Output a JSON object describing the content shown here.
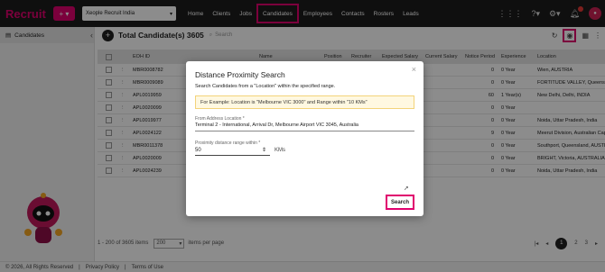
{
  "topbar": {
    "logo": "Recruit",
    "plus": "+ ▾",
    "org_select": "Xeople Recruit India",
    "nav": [
      "Home",
      "Clients",
      "Jobs",
      "Candidates",
      "Employees",
      "Contacts",
      "Rosters",
      "Leads"
    ],
    "active_nav": "Candidates",
    "accent": "#e0006e"
  },
  "sidebar": {
    "items": [
      {
        "label": "Candidates",
        "icon": "contacts-icon"
      }
    ]
  },
  "main": {
    "title": "Total Candidate(s) 3605",
    "search_placeholder": "Search"
  },
  "table": {
    "columns": [
      "",
      "",
      "EOH ID",
      "Name",
      "Position",
      "Recruiter",
      "Expected Salary",
      "Current Salary",
      "Notice Period",
      "Experience",
      "Location"
    ],
    "rows": [
      {
        "id": "MBR0008782",
        "notice": "0",
        "exp": "0 Year",
        "loc": "Wien, AUSTRIA"
      },
      {
        "id": "MBR0009089",
        "notice": "0",
        "exp": "0 Year",
        "loc": "FORTITUDE VALLEY, Queensland"
      },
      {
        "id": "APL0019959",
        "notice": "60",
        "exp": "1 Year(s)",
        "loc": "New Delhi, Delhi, INDIA"
      },
      {
        "id": "APL0020099",
        "notice": "0",
        "exp": "0 Year",
        "loc": ""
      },
      {
        "id": "APL0019977",
        "notice": "0",
        "exp": "0 Year",
        "loc": "Noida, Uttar Pradesh, India"
      },
      {
        "id": "APL0024122",
        "notice": "9",
        "exp": "0 Year",
        "loc": "Meerut Division, Australian Capit"
      },
      {
        "id": "MBR0011378",
        "notice": "0",
        "exp": "0 Year",
        "loc": "Southport, Queensland, AUSTRAL"
      },
      {
        "id": "APL0020009",
        "notice": "0",
        "exp": "0 Year",
        "loc": "BRIGHT, Victoria, AUSTRALIA"
      },
      {
        "id": "APL0024239",
        "notice": "0",
        "exp": "0 Year",
        "loc": "Noida, Uttar Pradesh, India"
      }
    ]
  },
  "pager": {
    "range": "1 - 200 of 3605 items",
    "per_page_value": "200",
    "per_page_label": "items per page",
    "pages": [
      "1",
      "2",
      "3"
    ],
    "current_page": "1"
  },
  "footer": {
    "copyright": "© 2026, All Rights Reserved",
    "privacy": "Privacy Policy",
    "terms": "Terms of Use"
  },
  "modal": {
    "title": "Distance Proximity Search",
    "description": "Search Candidates from a \"Location\" within the specified range.",
    "example": "For Example: Location is \"Melbourne VIC 3000\" and Range within \"10 KMs\"",
    "from_label": "From Address Location *",
    "from_value": "Terminal 2 - International, Arrival Dr, Melbourne Airport VIC 3045, Australia",
    "range_label": "Proximity distance range within *",
    "range_value": "50",
    "unit": "KMs",
    "search_button": "Search",
    "close": "×"
  }
}
